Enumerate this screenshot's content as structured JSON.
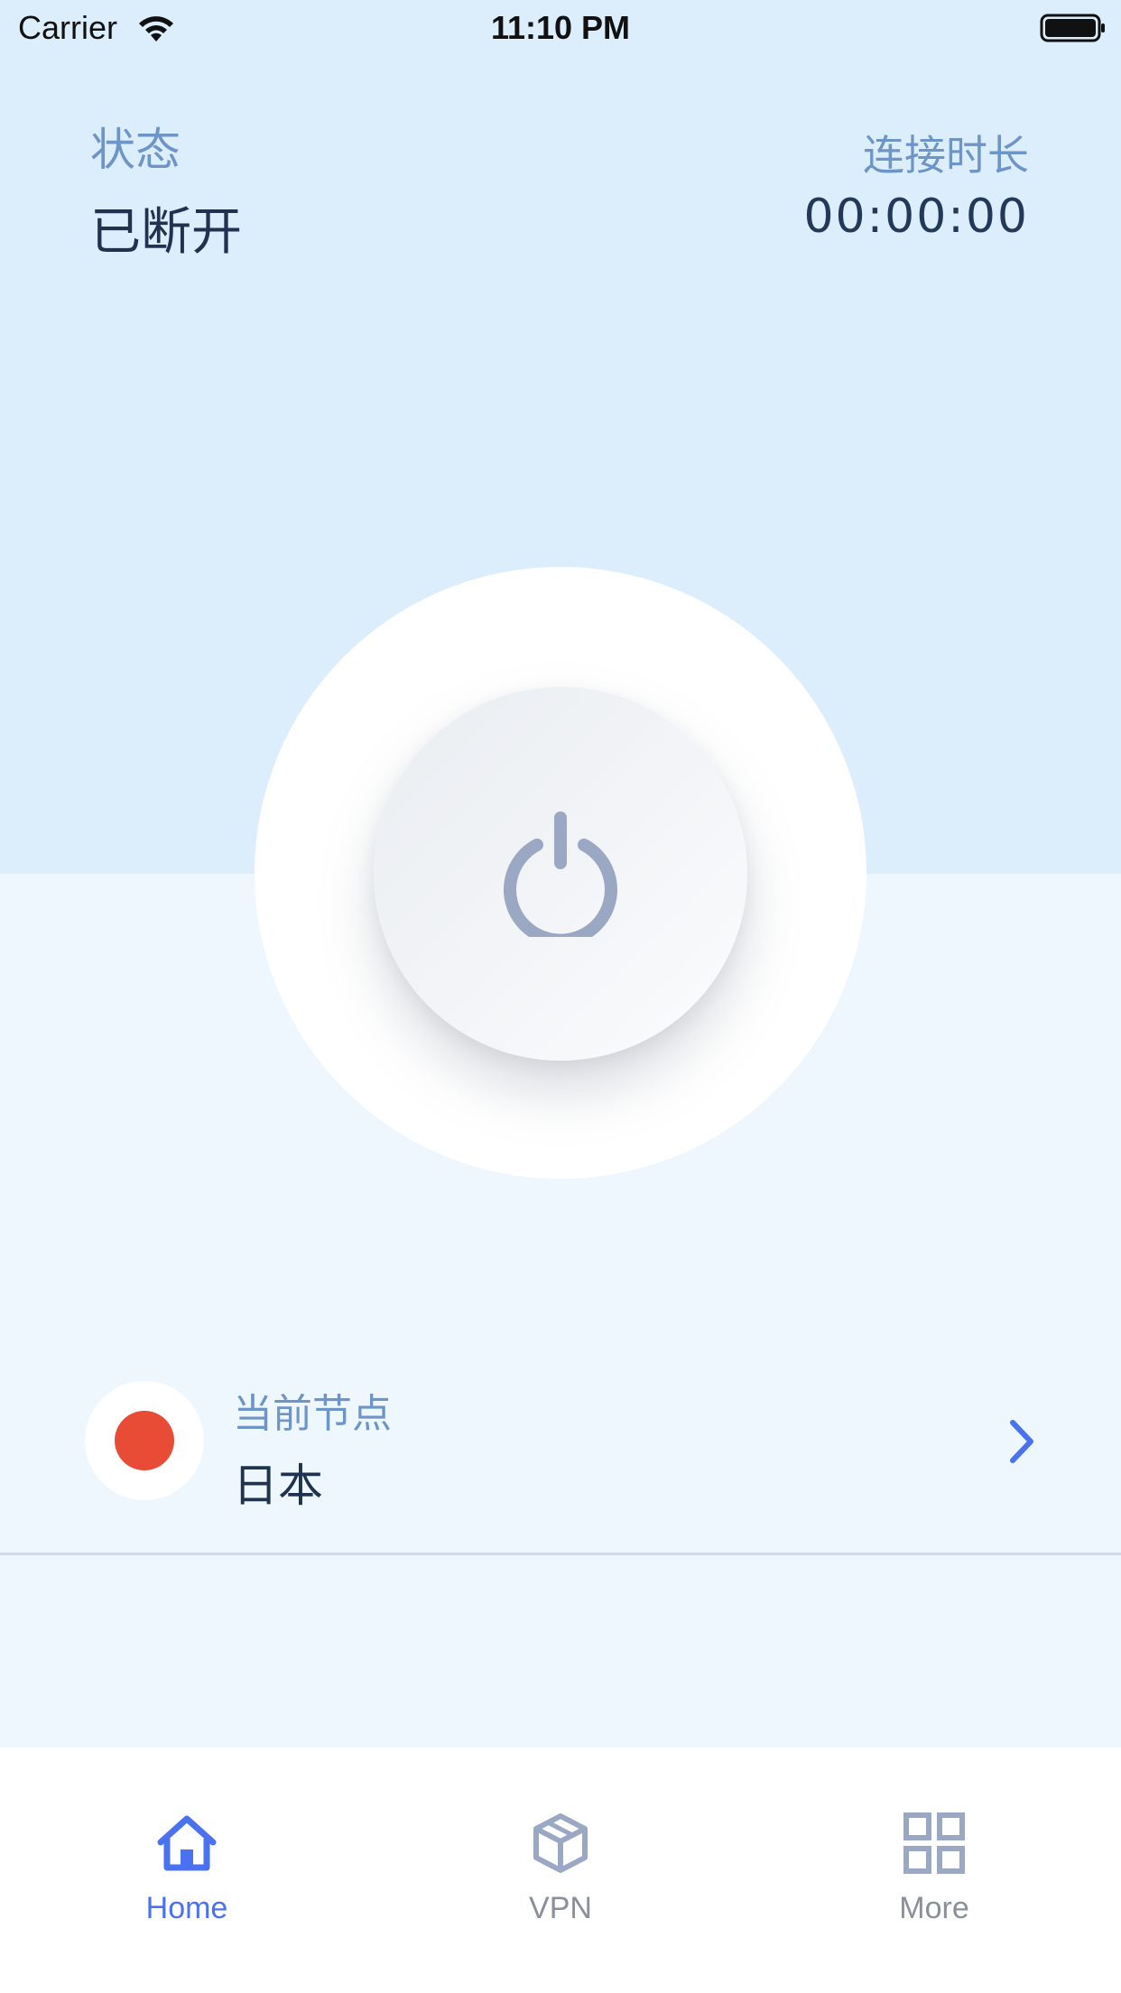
{
  "status_bar": {
    "carrier": "Carrier",
    "time": "11:10 PM"
  },
  "header": {
    "status_label": "状态",
    "status_value": "已断开",
    "duration_label": "连接时长",
    "duration_value": "00:00:00"
  },
  "power": {
    "icon": "power-icon"
  },
  "node": {
    "label": "当前节点",
    "name": "日本",
    "flag_color": "#e84c37"
  },
  "tabs": [
    {
      "label": "Home",
      "icon": "home-icon",
      "active": true
    },
    {
      "label": "VPN",
      "icon": "cube-icon",
      "active": false
    },
    {
      "label": "More",
      "icon": "grid-icon",
      "active": false
    }
  ],
  "colors": {
    "accent": "#4a72f0",
    "top_background": "#dcedfc",
    "lower_background": "#eef6fe",
    "label_blue": "#6d95c8",
    "power_icon": "#9aa8c4"
  }
}
